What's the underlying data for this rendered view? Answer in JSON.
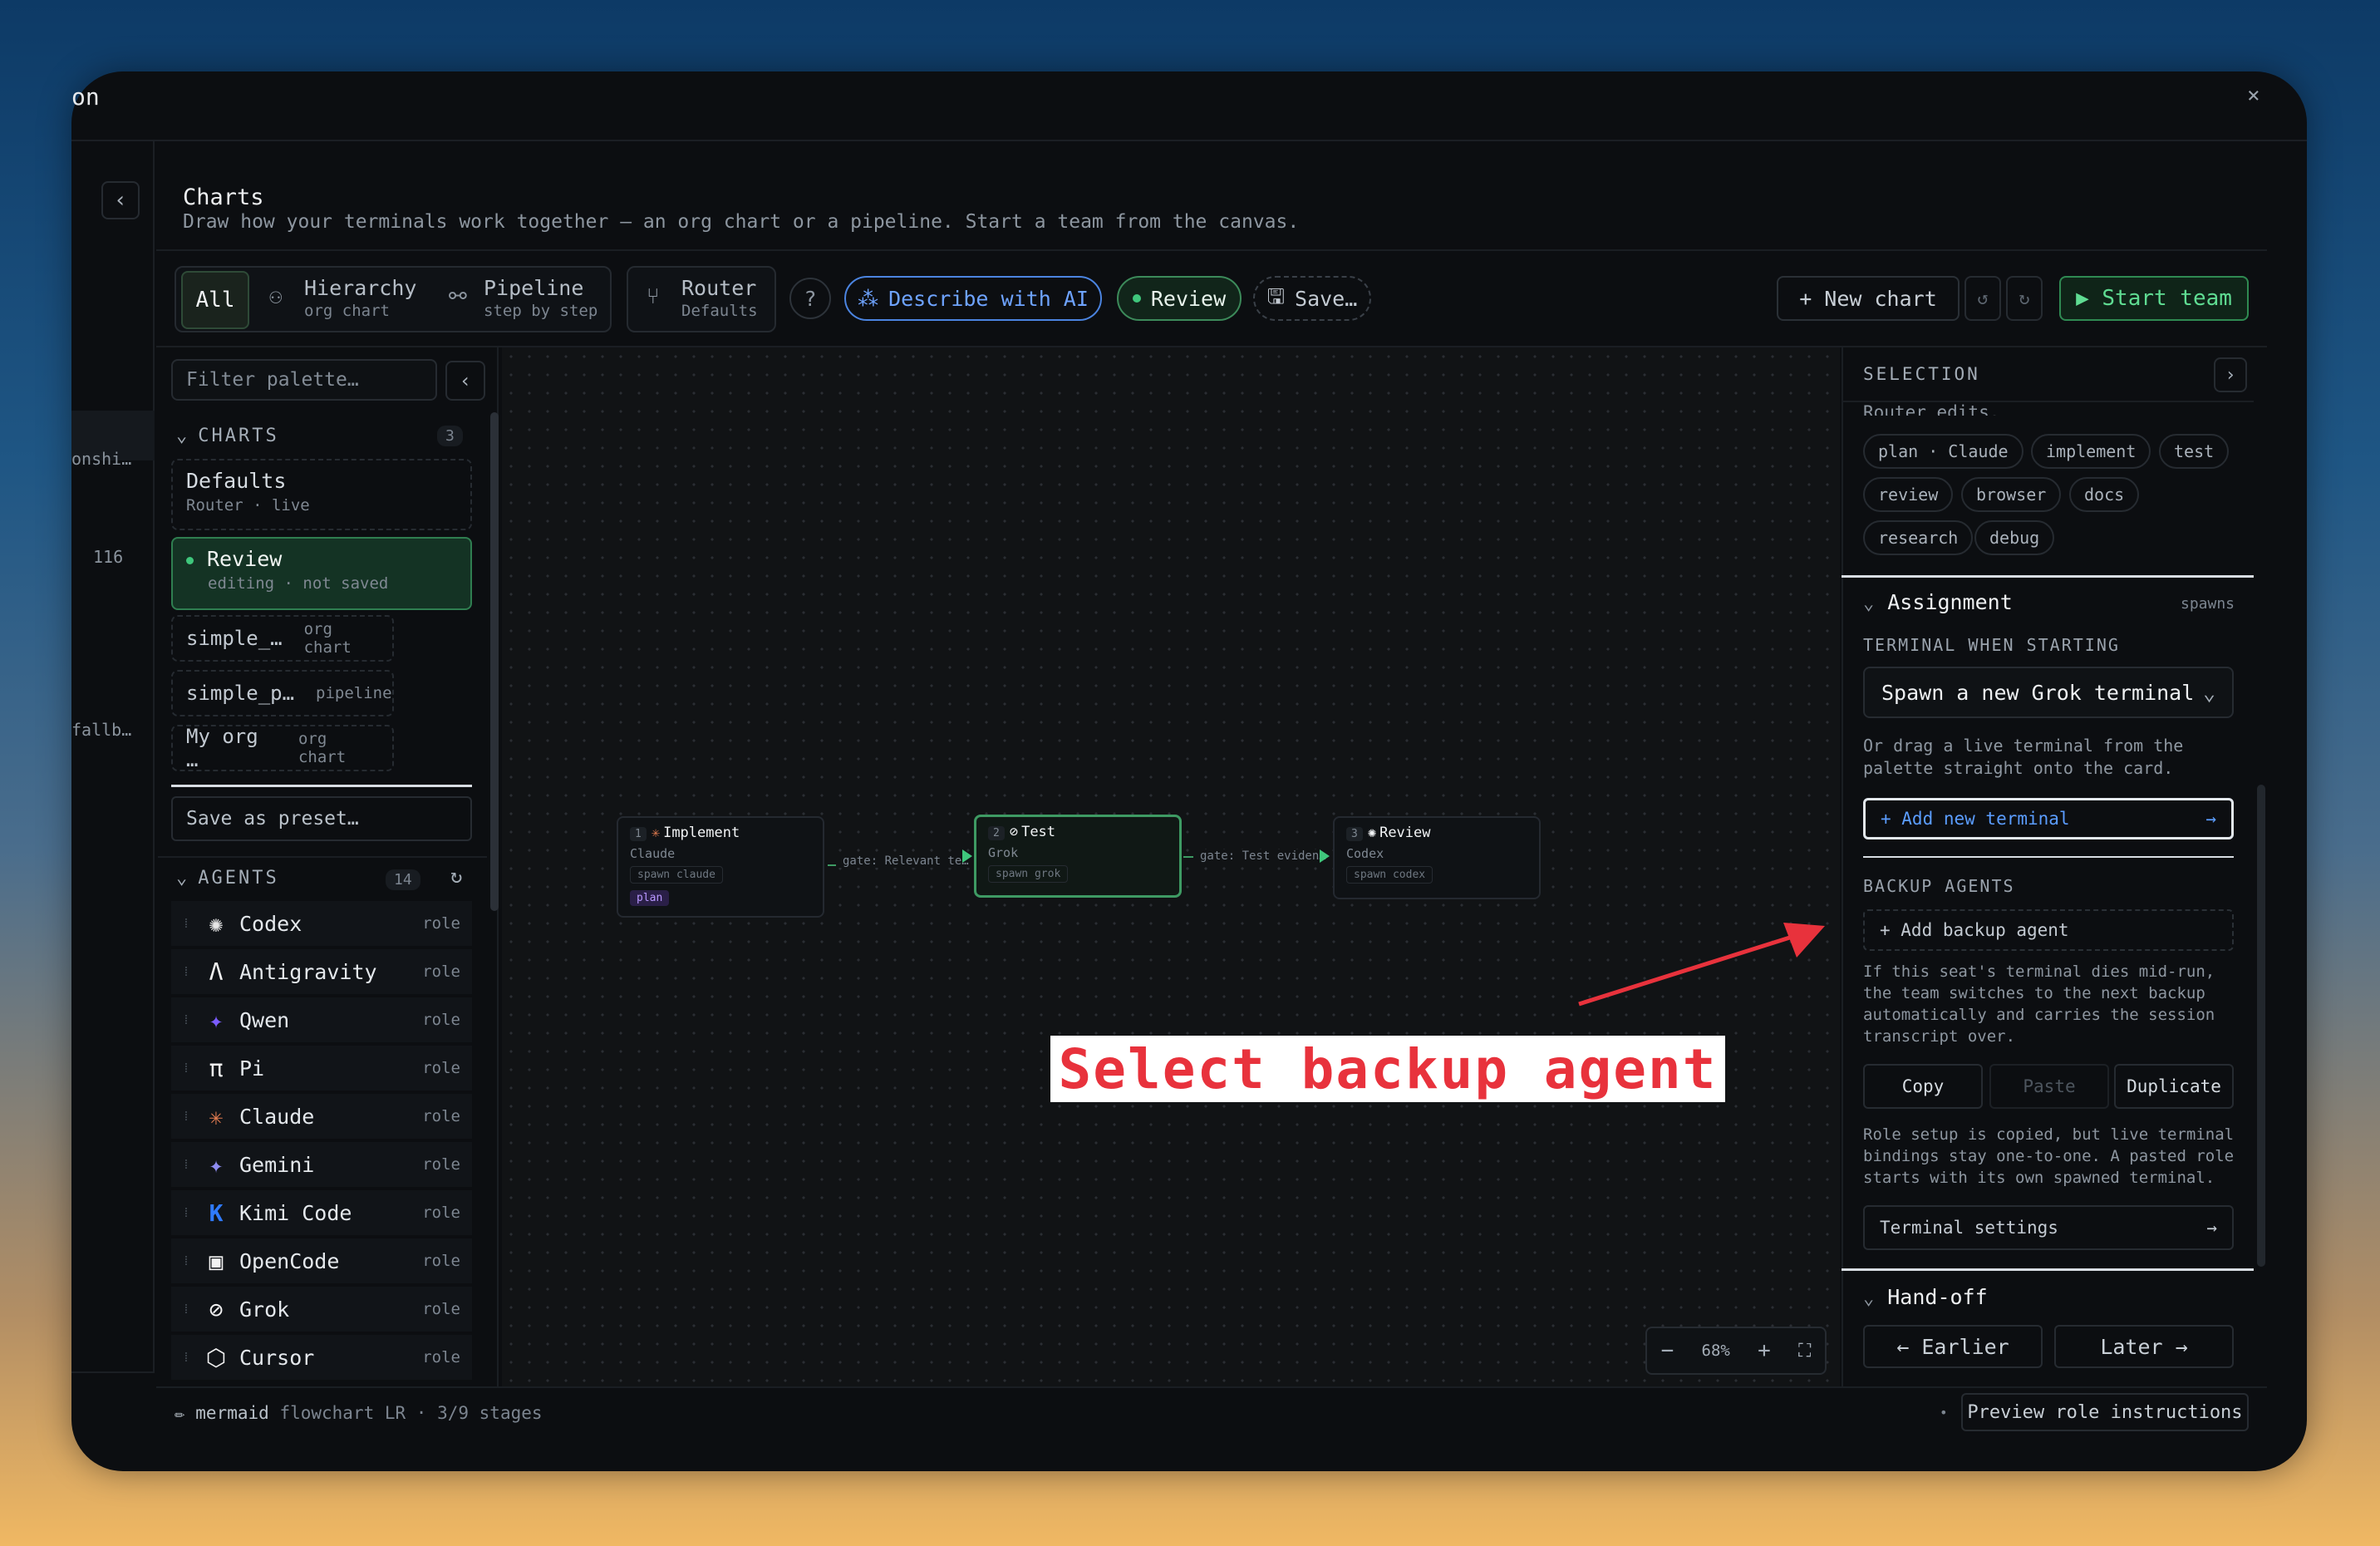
{
  "window": {
    "title": "on",
    "close": "×"
  },
  "left_strip": {
    "item1": "onshi…",
    "item2": "116",
    "item3": "fallb…"
  },
  "header": {
    "title": "Charts",
    "subtitle": "Draw how your terminals work together — an org chart or a pipeline. Start a team from the canvas."
  },
  "toolbar": {
    "all": "All",
    "hierarchy": {
      "label": "Hierarchy",
      "sub": "org chart"
    },
    "pipeline": {
      "label": "Pipeline",
      "sub": "step by step"
    },
    "router": {
      "label": "Router",
      "sub": "Defaults"
    },
    "help": "?",
    "describe_ai": "Describe with AI",
    "review": "Review",
    "save": "Save…",
    "new_chart": "+ New chart",
    "undo": "↺",
    "redo": "↻",
    "start_team": "▶ Start team"
  },
  "palette": {
    "filter_placeholder": "Filter palette…",
    "charts_label": "CHARTS",
    "charts_count": "3",
    "charts": [
      {
        "name": "Defaults",
        "meta": "Router · live"
      },
      {
        "name": "Review",
        "meta": "editing · not saved"
      }
    ],
    "chart_minis": [
      {
        "name": "simple_…",
        "meta": "org chart"
      },
      {
        "name": "simple_p…",
        "meta": "pipeline"
      },
      {
        "name": "My org …",
        "meta": "org chart"
      }
    ],
    "save_preset": "Save as preset…",
    "agents_label": "AGENTS",
    "agents_count": "14",
    "agents": [
      {
        "name": "Codex",
        "role": "role",
        "icon": "✺"
      },
      {
        "name": "Antigravity",
        "role": "role",
        "icon": "Λ"
      },
      {
        "name": "Qwen",
        "role": "role",
        "icon": "✦"
      },
      {
        "name": "Pi",
        "role": "role",
        "icon": "π"
      },
      {
        "name": "Claude",
        "role": "role",
        "icon": "✳"
      },
      {
        "name": "Gemini",
        "role": "role",
        "icon": "✦"
      },
      {
        "name": "Kimi Code",
        "role": "role",
        "icon": "K"
      },
      {
        "name": "OpenCode",
        "role": "role",
        "icon": "▣"
      },
      {
        "name": "Grok",
        "role": "role",
        "icon": "⊘"
      },
      {
        "name": "Cursor",
        "role": "role",
        "icon": "⬡"
      }
    ]
  },
  "canvas": {
    "nodes": [
      {
        "idx": "1",
        "title": "Implement",
        "sub": "Claude",
        "chip": "spawn claude",
        "tag": "plan"
      },
      {
        "idx": "2",
        "title": "Test",
        "sub": "Grok",
        "chip": "spawn grok"
      },
      {
        "idx": "3",
        "title": "Review",
        "sub": "Codex",
        "chip": "spawn codex"
      }
    ],
    "edges": [
      "gate: Relevant te…",
      "gate: Test eviden…"
    ],
    "zoom": {
      "minus": "−",
      "pct": "68%",
      "plus": "+",
      "fit": "⛶"
    },
    "callout": "Select backup agent",
    "arrow_color": "#e8323c"
  },
  "selection": {
    "header": "SELECTION",
    "cut_text": "Router edits.",
    "tags": [
      "plan · Claude",
      "implement",
      "test",
      "review",
      "browser",
      "docs",
      "research",
      "debug"
    ],
    "assignment": "Assignment",
    "spawns": "spawns",
    "terminal_label": "TERMINAL WHEN STARTING",
    "terminal_value": "Spawn a new Grok terminal",
    "terminal_help": "Or drag a live terminal from the palette straight onto the card.",
    "add_terminal": "+ Add new terminal",
    "backup_label": "BACKUP AGENTS",
    "add_backup": "+ Add backup agent",
    "backup_help": "If this seat's terminal dies mid-run, the team switches to the next backup automatically and carries the session transcript over.",
    "copy": "Copy",
    "paste": "Paste",
    "duplicate": "Duplicate",
    "role_help": "Role setup is copied, but live terminal bindings stay one-to-one. A pasted role starts with its own spawned terminal.",
    "terminal_settings": "Terminal settings",
    "handoff": "Hand-off",
    "earlier": "← Earlier",
    "later": "Later →"
  },
  "footer": {
    "left_prefix": "✏ mermaid",
    "left_rest": " flowchart LR · 3/9 stages",
    "preview": "Preview role instructions"
  }
}
